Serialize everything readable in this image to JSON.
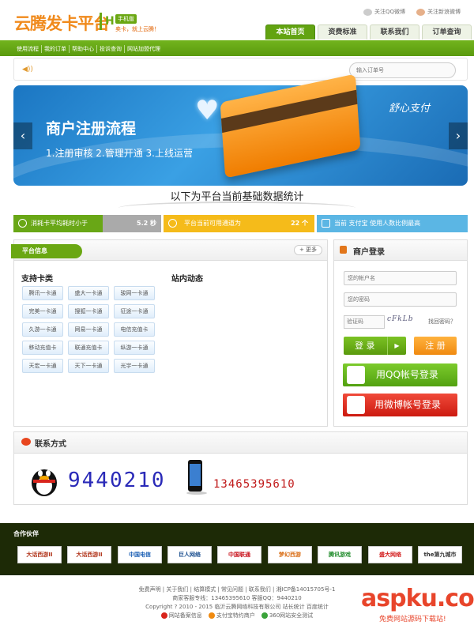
{
  "header": {
    "logo_text": "云腾发卡平台",
    "logo_mark": "H",
    "badge": "手机版",
    "slogan": "卖卡，就上云腾！",
    "social_qq": "关注QQ微博",
    "social_weibo": "关注新浪微博",
    "nav": [
      "本站首页",
      "资费标准",
      "联系我们",
      "订单查询"
    ]
  },
  "subnav": [
    "使用流程",
    "我的订单",
    "帮助中心",
    "投诉查询",
    "网站加盟代理"
  ],
  "search": {
    "placeholder": "输入订单号"
  },
  "banner": {
    "title": "商户注册流程",
    "steps": "1.注册审核  2.管理开通  3.上线运营",
    "brand": "舒心支付"
  },
  "stats": {
    "title": "以下为平台当前基础数据统计",
    "items": [
      {
        "label": "消耗卡平均耗时小于",
        "value": "5.2 秒"
      },
      {
        "label": "平台当前可用通道为",
        "value": "22 个"
      },
      {
        "label": "当前 支付宝 使用人数比例最高",
        "value": ""
      }
    ]
  },
  "platform": {
    "tab": "平台信息",
    "more": "更多",
    "cards_title": "支持卡类",
    "news_title": "站内动态",
    "cards": [
      "腾讯一卡通",
      "盛大一卡通",
      "骏网一卡通",
      "完美一卡通",
      "搜狐一卡通",
      "征途一卡通",
      "久游一卡通",
      "网易一卡通",
      "电信充值卡",
      "移动充值卡",
      "联通充值卡",
      "纵游一卡通",
      "天宏一卡通",
      "天下一卡通",
      "光宇一卡通"
    ]
  },
  "login": {
    "title": "商户登录",
    "account_placeholder": "您的帐户名",
    "password_placeholder": "您的密码",
    "captcha_placeholder": "验证码",
    "captcha_text": "cFkLb",
    "forgot": "找回密码？",
    "login_btn": "登 录",
    "register_btn": "注 册",
    "qq_btn": "用QQ帐号登录",
    "weibo_btn": "用微博帐号登录"
  },
  "contact": {
    "title": "联系方式",
    "qq": "9440210",
    "phone": "13465395610"
  },
  "partners": {
    "title": "合作伙伴",
    "logos": [
      "大话西游II",
      "大话西游II",
      "中国电信",
      "巨人网络",
      "中国联通",
      "梦幻西游",
      "腾讯游戏",
      "盛大网络",
      "the第九城市"
    ]
  },
  "footer": {
    "links": "免费声明 | 关于我们 | 结算模式 | 常见问题 | 联系我们 | 湘ICP备14015705号-1",
    "hotline": "商家客服专线：13465395610 客服QQ：9440210",
    "copyright": "Copyright ? 2010 - 2015 临沂云腾网络科技有限公司 站长统计 百度统计",
    "badges": [
      "网站备案信息",
      "支付宝特约商户",
      "360网站安全测试"
    ]
  },
  "watermark": {
    "main": "aspku.com",
    "sub": "免费网站源码下载站!"
  }
}
